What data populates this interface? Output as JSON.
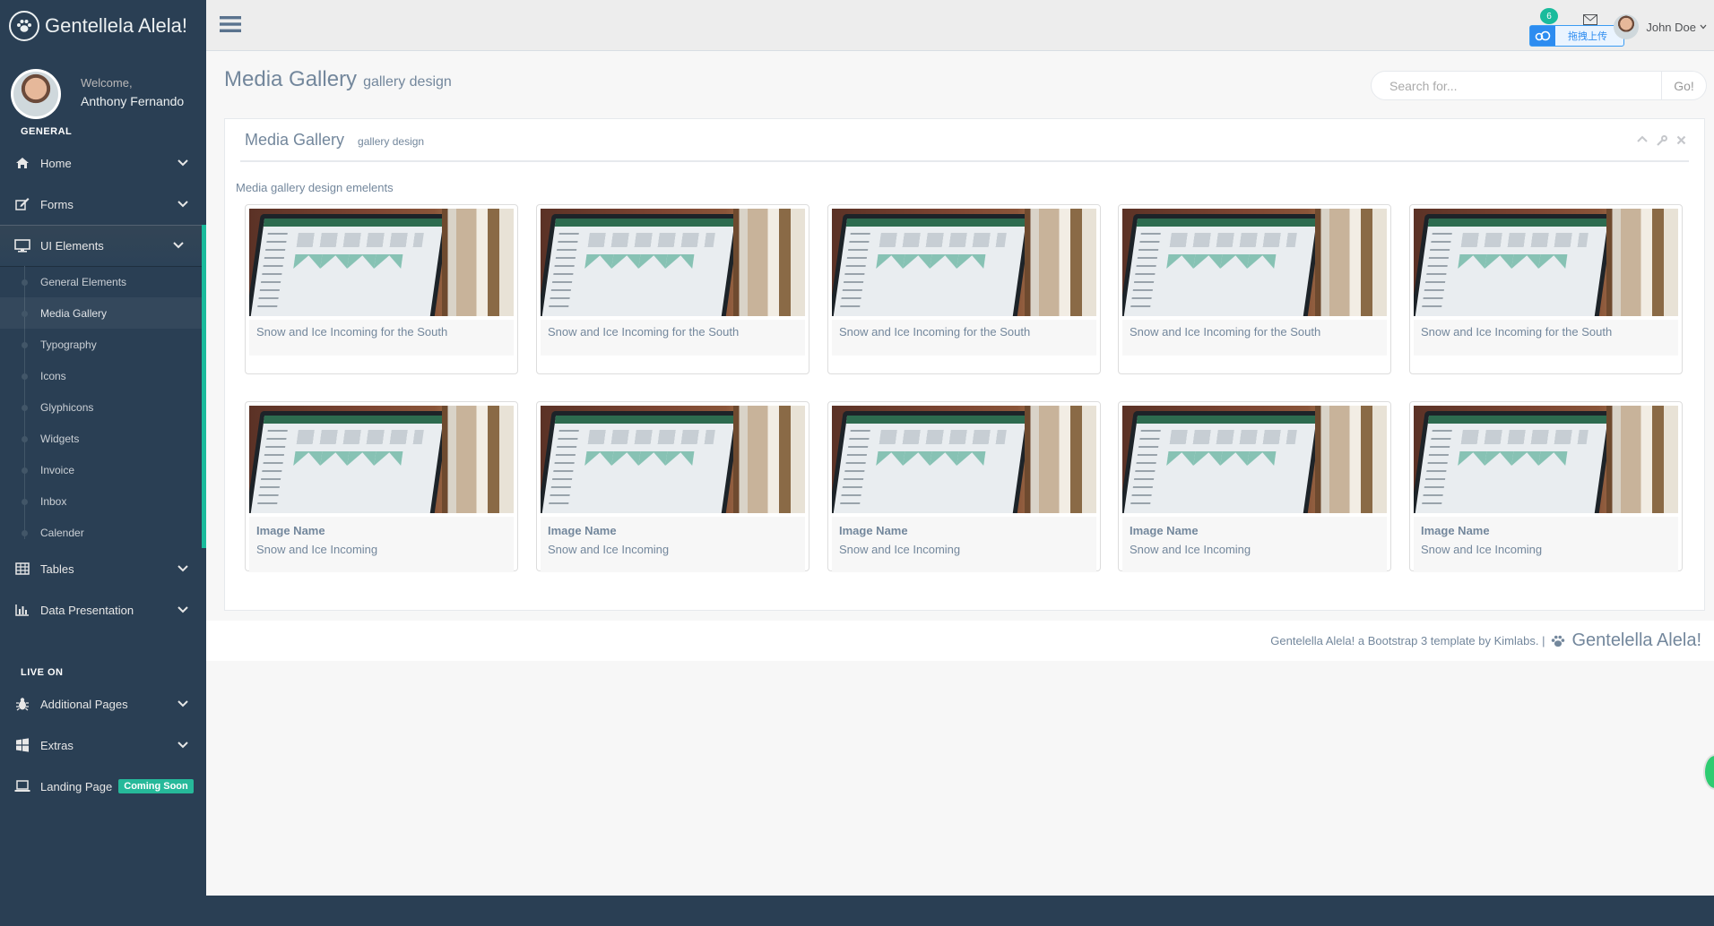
{
  "brand": {
    "name": "Gentellela Alela!"
  },
  "profile": {
    "welcome": "Welcome,",
    "name": "Anthony Fernando"
  },
  "sidebar": {
    "section_general": "GENERAL",
    "section_live": "LIVE ON",
    "items": [
      {
        "label": "Home",
        "icon": "home-icon"
      },
      {
        "label": "Forms",
        "icon": "edit-icon"
      },
      {
        "label": "UI Elements",
        "icon": "desktop-icon"
      },
      {
        "label": "Tables",
        "icon": "table-icon"
      },
      {
        "label": "Data Presentation",
        "icon": "bar-chart-icon"
      }
    ],
    "ui_sub": [
      "General Elements",
      "Media Gallery",
      "Typography",
      "Icons",
      "Glyphicons",
      "Widgets",
      "Invoice",
      "Inbox",
      "Calender"
    ],
    "live_items": [
      {
        "label": "Additional Pages",
        "icon": "bug-icon"
      },
      {
        "label": "Extras",
        "icon": "windows-icon"
      },
      {
        "label": "Landing Page",
        "icon": "laptop-icon",
        "badge": "Coming Soon"
      }
    ]
  },
  "topnav": {
    "user_name": "John Doe",
    "mail_count": "6",
    "upload_label": "拖拽上传"
  },
  "page": {
    "title": "Media Gallery",
    "subtitle": "gallery design"
  },
  "search": {
    "placeholder": "Search for...",
    "button": "Go!"
  },
  "panel": {
    "title": "Media Gallery",
    "subtitle": "gallery design",
    "description": "Media gallery design emelents"
  },
  "gallery": {
    "row1": [
      {
        "caption": "Snow and Ice Incoming for the South"
      },
      {
        "caption": "Snow and Ice Incoming for the South"
      },
      {
        "caption": "Snow and Ice Incoming for the South"
      },
      {
        "caption": "Snow and Ice Incoming for the South"
      },
      {
        "caption": "Snow and Ice Incoming for the South"
      }
    ],
    "row2": [
      {
        "name": "Image Name",
        "caption": "Snow and Ice Incoming"
      },
      {
        "name": "Image Name",
        "caption": "Snow and Ice Incoming"
      },
      {
        "name": "Image Name",
        "caption": "Snow and Ice Incoming"
      },
      {
        "name": "Image Name",
        "caption": "Snow and Ice Incoming"
      },
      {
        "name": "Image Name",
        "caption": "Snow and Ice Incoming"
      }
    ]
  },
  "footer": {
    "text": "Gentelella Alela! a Bootstrap 3 template by Kimlabs. |",
    "brand": "Gentelella Alela!"
  },
  "colors": {
    "sidebar_bg": "#2A3F54",
    "accent": "#1ABB9C",
    "text": "#73879C",
    "content_bg": "#F7F7F7"
  }
}
